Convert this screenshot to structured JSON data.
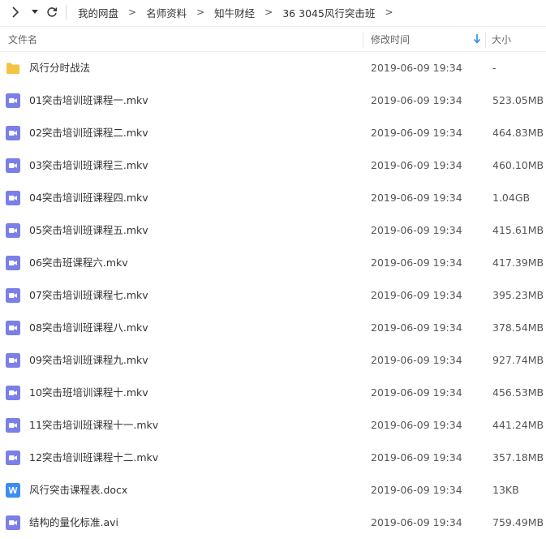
{
  "nav": {
    "breadcrumbs": [
      "我的网盘",
      "名师资料",
      "知牛财经",
      "36 3045风行突击班"
    ],
    "sep": ">"
  },
  "columns": {
    "name": "文件名",
    "time": "修改时间",
    "size": "大小"
  },
  "colors": {
    "folder": "#f5c342",
    "video": "#7b7fe8",
    "word": "#3d8ef0",
    "sort_arrow": "#2b8cf0"
  },
  "files": [
    {
      "name": "风行分时战法",
      "time": "2019-06-09 19:34",
      "size": "-",
      "icon": "folder-icon"
    },
    {
      "name": "01突击培训班课程一.mkv",
      "time": "2019-06-09 19:34",
      "size": "523.05MB",
      "icon": "video-file-icon"
    },
    {
      "name": "02突击培训班课程二.mkv",
      "time": "2019-06-09 19:34",
      "size": "464.83MB",
      "icon": "video-file-icon"
    },
    {
      "name": "03突击培训班课程三.mkv",
      "time": "2019-06-09 19:34",
      "size": "460.10MB",
      "icon": "video-file-icon"
    },
    {
      "name": "04突击培训班课程四.mkv",
      "time": "2019-06-09 19:34",
      "size": "1.04GB",
      "icon": "video-file-icon"
    },
    {
      "name": "05突击培训班课程五.mkv",
      "time": "2019-06-09 19:34",
      "size": "415.61MB",
      "icon": "video-file-icon"
    },
    {
      "name": "06突击班课程六.mkv",
      "time": "2019-06-09 19:34",
      "size": "417.39MB",
      "icon": "video-file-icon"
    },
    {
      "name": "07突击培训班课程七.mkv",
      "time": "2019-06-09 19:34",
      "size": "395.23MB",
      "icon": "video-file-icon"
    },
    {
      "name": "08突击培训班课程八.mkv",
      "time": "2019-06-09 19:34",
      "size": "378.54MB",
      "icon": "video-file-icon"
    },
    {
      "name": "09突击培训班课程九.mkv",
      "time": "2019-06-09 19:34",
      "size": "927.74MB",
      "icon": "video-file-icon"
    },
    {
      "name": "10突击班培训课程十.mkv",
      "time": "2019-06-09 19:34",
      "size": "456.53MB",
      "icon": "video-file-icon"
    },
    {
      "name": "11突击培训班课程十一.mkv",
      "time": "2019-06-09 19:34",
      "size": "441.24MB",
      "icon": "video-file-icon"
    },
    {
      "name": "12突击培训班课程十二.mkv",
      "time": "2019-06-09 19:34",
      "size": "357.18MB",
      "icon": "video-file-icon"
    },
    {
      "name": "风行突击课程表.docx",
      "time": "2019-06-09 19:34",
      "size": "13KB",
      "icon": "word-file-icon"
    },
    {
      "name": "结构的量化标准.avi",
      "time": "2019-06-09 19:34",
      "size": "759.49MB",
      "icon": "video-file-icon"
    }
  ]
}
